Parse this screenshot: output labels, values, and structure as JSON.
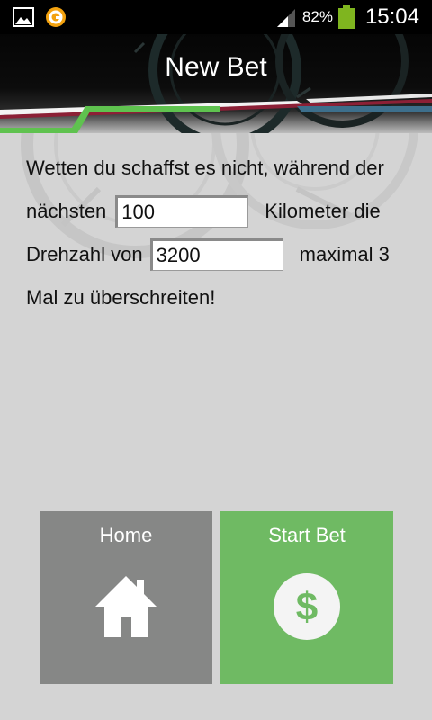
{
  "status_bar": {
    "battery_percent": "82%",
    "time": "15:04",
    "icons": [
      "gallery-icon",
      "app-notification-icon",
      "signal-icon",
      "battery-icon"
    ]
  },
  "header": {
    "title": "New Bet"
  },
  "bet": {
    "line1": "Wetten du schaffst es nicht, während der",
    "line2_prefix": "nächsten",
    "km_value": "100",
    "line2_suffix": "Kilometer die",
    "line3_prefix": "Drehzahl von",
    "rpm_value": "3200",
    "line3_suffix": "maximal 3",
    "line4": "Mal zu überschreiten!"
  },
  "buttons": {
    "home_label": "Home",
    "start_label": "Start Bet"
  },
  "colors": {
    "background": "#d4d4d4",
    "home_button": "#868786",
    "start_button": "#6fba63",
    "accent_green": "#5fc24f",
    "accent_red": "#8c2036",
    "accent_blue": "#3d6f8c"
  }
}
